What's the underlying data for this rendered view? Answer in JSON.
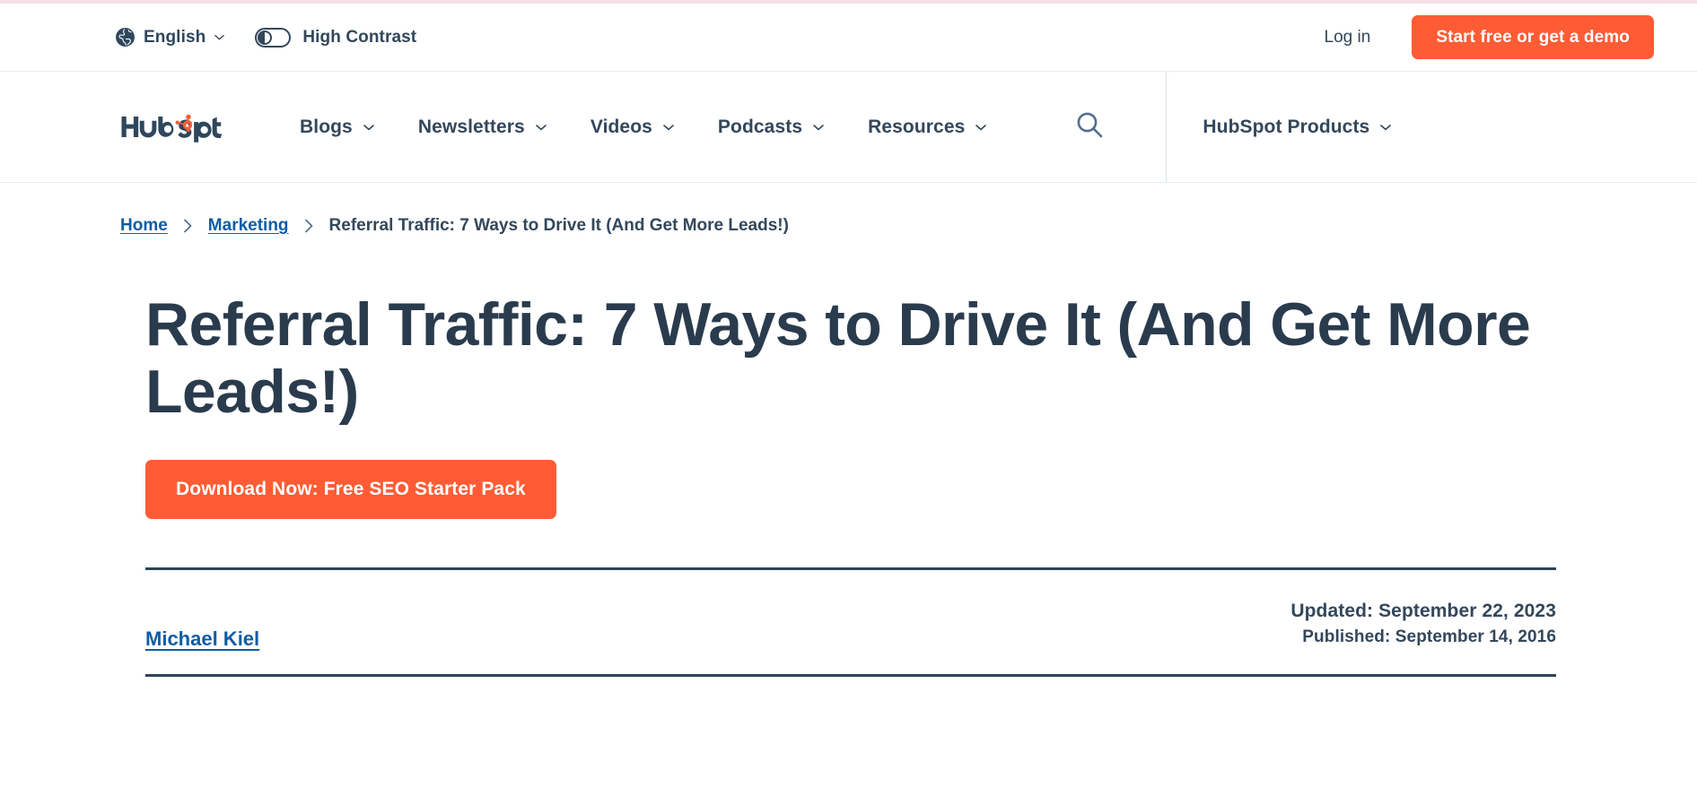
{
  "utility_bar": {
    "language": {
      "icon": "globe-icon",
      "label": "English",
      "chevron": "chevron-down-icon"
    },
    "high_contrast": {
      "icon": "contrast-toggle-icon",
      "label": "High Contrast",
      "enabled": false
    },
    "login_label": "Log in",
    "cta_label": "Start free or get a demo",
    "cta_color": "#ff5c35"
  },
  "nav": {
    "logo_text": "HubSpot",
    "items": [
      {
        "label": "Blogs",
        "chevron": "chevron-down-icon"
      },
      {
        "label": "Newsletters",
        "chevron": "chevron-down-icon"
      },
      {
        "label": "Videos",
        "chevron": "chevron-down-icon"
      },
      {
        "label": "Podcasts",
        "chevron": "chevron-down-icon"
      },
      {
        "label": "Resources",
        "chevron": "chevron-down-icon"
      }
    ],
    "search_icon": "search-icon",
    "products": {
      "label": "HubSpot Products",
      "chevron": "chevron-down-icon"
    }
  },
  "breadcrumb": {
    "home": "Home",
    "section": "Marketing",
    "current": "Referral Traffic: 7 Ways to Drive It (And Get More Leads!)",
    "separator": "chevron-right-icon",
    "link_color": "#0d5ca6"
  },
  "article": {
    "title": "Referral Traffic: 7 Ways to Drive It (And Get More Leads!)",
    "cta_label": "Download Now: Free SEO Starter Pack",
    "author": "Michael Kiel",
    "updated": "Updated: September 22, 2023",
    "published": "Published: September 14, 2016",
    "title_color": "#2a3b4d"
  }
}
